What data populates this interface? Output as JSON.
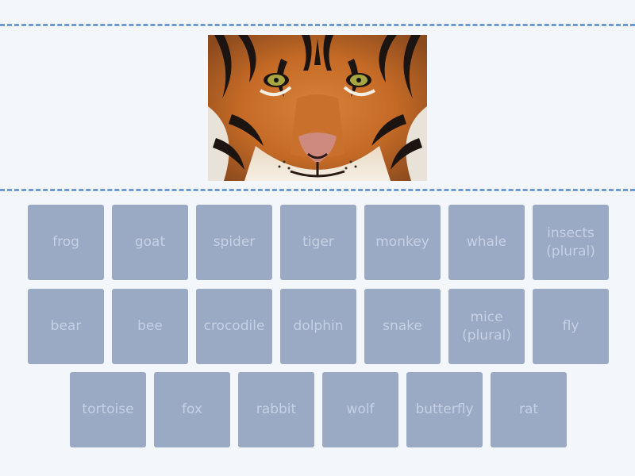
{
  "question": {
    "image": {
      "subject": "tiger face"
    }
  },
  "answers": {
    "row1": [
      "frog",
      "goat",
      "spider",
      "tiger",
      "monkey",
      "whale",
      "insects\n(plural)"
    ],
    "row2": [
      "bear",
      "bee",
      "crocodile",
      "dolphin",
      "snake",
      "mice\n(plural)",
      "fly"
    ],
    "row3": [
      "tortoise",
      "fox",
      "rabbit",
      "wolf",
      "butterfly",
      "rat"
    ]
  },
  "colors": {
    "background": "#f3f7fb",
    "dashes": "#6e9bd1",
    "tile": "#9aa9c4",
    "tile_text": "#c6d1e3"
  }
}
